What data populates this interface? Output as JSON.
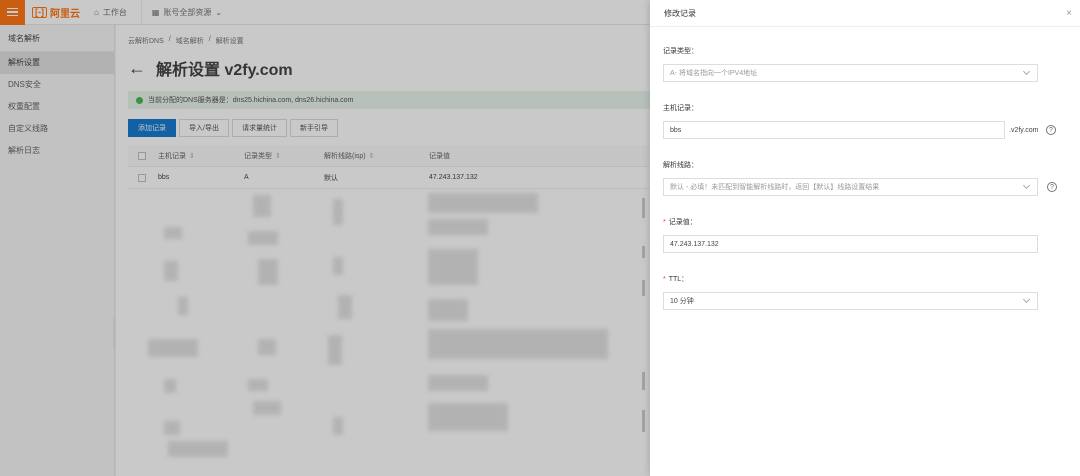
{
  "topbar": {
    "logo": "阿里云",
    "logo_mark": "[-]",
    "workbench": "工作台",
    "account": "账号全部资源"
  },
  "sidebar": {
    "title": "域名解析",
    "items": [
      {
        "label": "解析设置",
        "active": true
      },
      {
        "label": "DNS安全"
      },
      {
        "label": "权重配置"
      },
      {
        "label": "自定义线路"
      },
      {
        "label": "解析日志"
      }
    ]
  },
  "main": {
    "breadcrumb": [
      "云解析DNS",
      "/",
      "域名解析",
      "/",
      "解析设置"
    ],
    "title": "解析设置 v2fy.com",
    "notice": "当前分配的DNS服务器是：dns25.hichina.com, dns26.hichina.com",
    "actions": {
      "add": "添加记录",
      "import": "导入/导出",
      "stats": "请求量统计",
      "guide": "新手引导"
    },
    "table": {
      "headers": [
        "主机记录",
        "记录类型",
        "解析线路(isp)",
        "记录值"
      ],
      "rows": [
        [
          "bbs",
          "A",
          "默认",
          "47.243.137.132"
        ]
      ]
    }
  },
  "drawer": {
    "title": "修改记录",
    "close": "×",
    "fields": {
      "type": {
        "label": "记录类型：",
        "value": "A- 将域名指向一个IPV4地址"
      },
      "host": {
        "label": "主机记录：",
        "value": "bbs",
        "suffix": ".v2fy.com"
      },
      "line": {
        "label": "解析线路：",
        "value": "默认 - 必填！未匹配到智能解析线路时，返回【默认】线路设置结果"
      },
      "record_value": {
        "label": "记录值：",
        "value": "47.243.137.132"
      },
      "ttl": {
        "label": "TTL：",
        "value": "10 分钟"
      }
    },
    "help": "?"
  }
}
